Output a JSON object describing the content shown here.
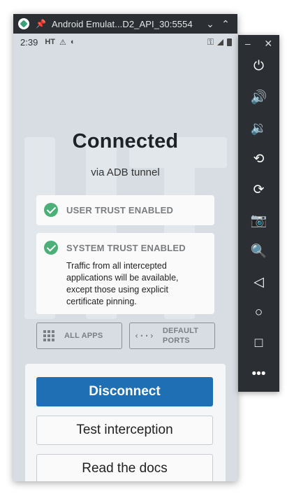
{
  "emulator": {
    "title": "Android Emulat...D2_API_30:5554",
    "pin_glyph": "📌",
    "minimize_glyph": "⌄",
    "maximize_glyph": "⌃",
    "toolbar": {
      "minimize": "–",
      "close": "✕",
      "items": [
        {
          "name": "power-icon",
          "glyph": "⏻"
        },
        {
          "name": "volume-up-icon",
          "glyph": "🔊"
        },
        {
          "name": "volume-down-icon",
          "glyph": "🔉"
        },
        {
          "name": "rotate-left-icon",
          "glyph": "⟲"
        },
        {
          "name": "rotate-right-icon",
          "glyph": "⟳"
        },
        {
          "name": "camera-icon",
          "glyph": "📷"
        },
        {
          "name": "zoom-icon",
          "glyph": "🔍"
        },
        {
          "name": "back-icon",
          "glyph": "◁"
        },
        {
          "name": "home-icon",
          "glyph": "○"
        },
        {
          "name": "overview-icon",
          "glyph": "□"
        },
        {
          "name": "more-icon",
          "glyph": "•••"
        }
      ]
    }
  },
  "status_bar": {
    "time": "2:39",
    "left_icons": [
      "HT",
      "⚠",
      "◐"
    ],
    "right_icons": [
      "⚿"
    ]
  },
  "app": {
    "title": "Connected",
    "subtitle": "via ADB tunnel",
    "user_trust": {
      "label": "USER TRUST ENABLED"
    },
    "system_trust": {
      "label": "SYSTEM TRUST ENABLED",
      "description": "Traffic from all intercepted applications will be available, except those using explicit certificate pinning."
    },
    "options": {
      "apps_label": "ALL APPS",
      "ports_label_line1": "DEFAULT",
      "ports_label_line2": "PORTS",
      "ports_glyph": "‹··›"
    },
    "buttons": {
      "disconnect": "Disconnect",
      "test": "Test interception",
      "docs": "Read the docs"
    }
  },
  "colors": {
    "accent": "#1f6fb5",
    "success": "#4caf78",
    "background": "#d7dde2",
    "toolbar": "#2b2e33"
  }
}
